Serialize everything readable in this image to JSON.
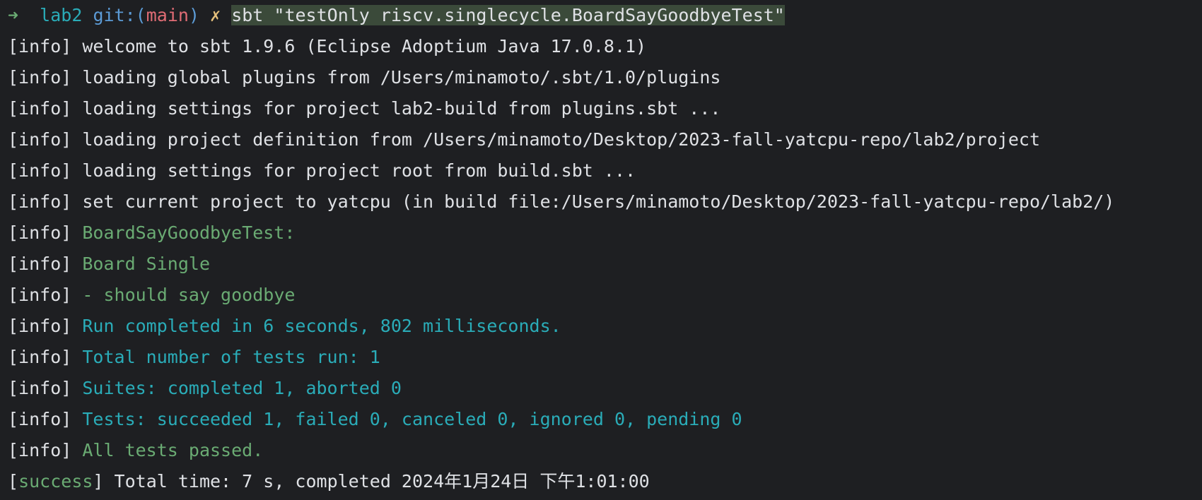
{
  "prompt": {
    "arrow": "➜",
    "dir": "lab2",
    "git_label": "git:(",
    "branch": "main",
    "git_close": ")",
    "dirty_mark": "✗",
    "command": "sbt \"testOnly riscv.singlecycle.BoardSayGoodbyeTest\""
  },
  "lines": [
    {
      "tag": "[info]",
      "text": "welcome to sbt 1.9.6 (Eclipse Adoptium Java 17.0.8.1)",
      "style": "plain"
    },
    {
      "tag": "[info]",
      "text": "loading global plugins from /Users/minamoto/.sbt/1.0/plugins",
      "style": "plain"
    },
    {
      "tag": "[info]",
      "text": "loading settings for project lab2-build from plugins.sbt ...",
      "style": "plain"
    },
    {
      "tag": "[info]",
      "text": "loading project definition from /Users/minamoto/Desktop/2023-fall-yatcpu-repo/lab2/project",
      "style": "plain"
    },
    {
      "tag": "[info]",
      "text": "loading settings for project root from build.sbt ...",
      "style": "plain"
    },
    {
      "tag": "[info]",
      "text": "set current project to yatcpu (in build file:/Users/minamoto/Desktop/2023-fall-yatcpu-repo/lab2/)",
      "style": "plain"
    },
    {
      "tag": "[info]",
      "text": "BoardSayGoodbyeTest:",
      "style": "green"
    },
    {
      "tag": "[info]",
      "text": "Board Single",
      "style": "green"
    },
    {
      "tag": "[info]",
      "text": "- should say goodbye",
      "style": "green"
    },
    {
      "tag": "[info]",
      "text": "Run completed in 6 seconds, 802 milliseconds.",
      "style": "cyan"
    },
    {
      "tag": "[info]",
      "text": "Total number of tests run: 1",
      "style": "cyan"
    },
    {
      "tag": "[info]",
      "text": "Suites: completed 1, aborted 0",
      "style": "cyan"
    },
    {
      "tag": "[info]",
      "text": "Tests: succeeded 1, failed 0, canceled 0, ignored 0, pending 0",
      "style": "cyan"
    },
    {
      "tag": "[info]",
      "text": "All tests passed.",
      "style": "green"
    }
  ],
  "final": {
    "open": "[",
    "word": "success",
    "close": "]",
    "text": "Total time: 7 s, completed 2024年1月24日 下午1:01:00"
  },
  "colors": {
    "background": "#1e1f22",
    "foreground": "#dfe1e5",
    "green": "#6aab73",
    "cyan": "#2aacb8",
    "branch": "#e06c75",
    "dirty": "#e5c07b",
    "selection": "#3b4a3a"
  }
}
